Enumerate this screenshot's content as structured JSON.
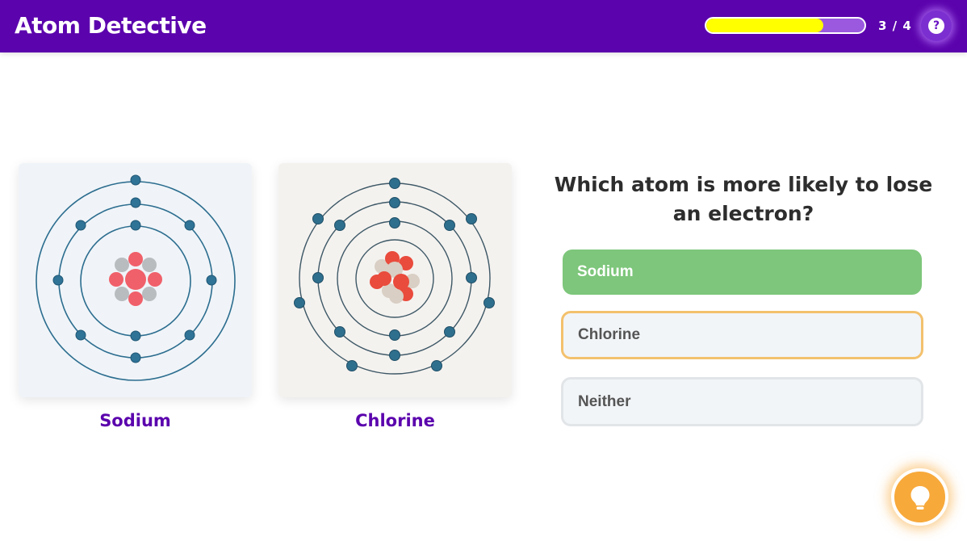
{
  "app": {
    "title": "Atom Detective"
  },
  "progress": {
    "current": 3,
    "total": 4,
    "label": "3 / 4",
    "fill_fraction": 0.74
  },
  "help": {
    "icon": "question-mark-icon",
    "glyph": "?"
  },
  "atoms": [
    {
      "name": "Sodium",
      "shells": [
        2,
        8,
        1
      ]
    },
    {
      "name": "Chlorine",
      "shells": [
        2,
        8,
        7
      ]
    }
  ],
  "question": {
    "text": "Which atom is more likely to lose an electron?"
  },
  "answers": [
    {
      "label": "Sodium",
      "state": "correct"
    },
    {
      "label": "Chlorine",
      "state": "selected"
    },
    {
      "label": "Neither",
      "state": "default"
    }
  ],
  "hint": {
    "icon": "lightbulb-icon"
  },
  "colors": {
    "header": "#5b03ad",
    "progress_fill": "#ffff00",
    "atom_label": "#5b03ad",
    "correct": "#7dc67b",
    "selected_border": "#f3c16d",
    "hint": "#f7a93a",
    "electron": "#2f7397",
    "proton": "#f0606a",
    "neutron": "#b9bcbf"
  }
}
